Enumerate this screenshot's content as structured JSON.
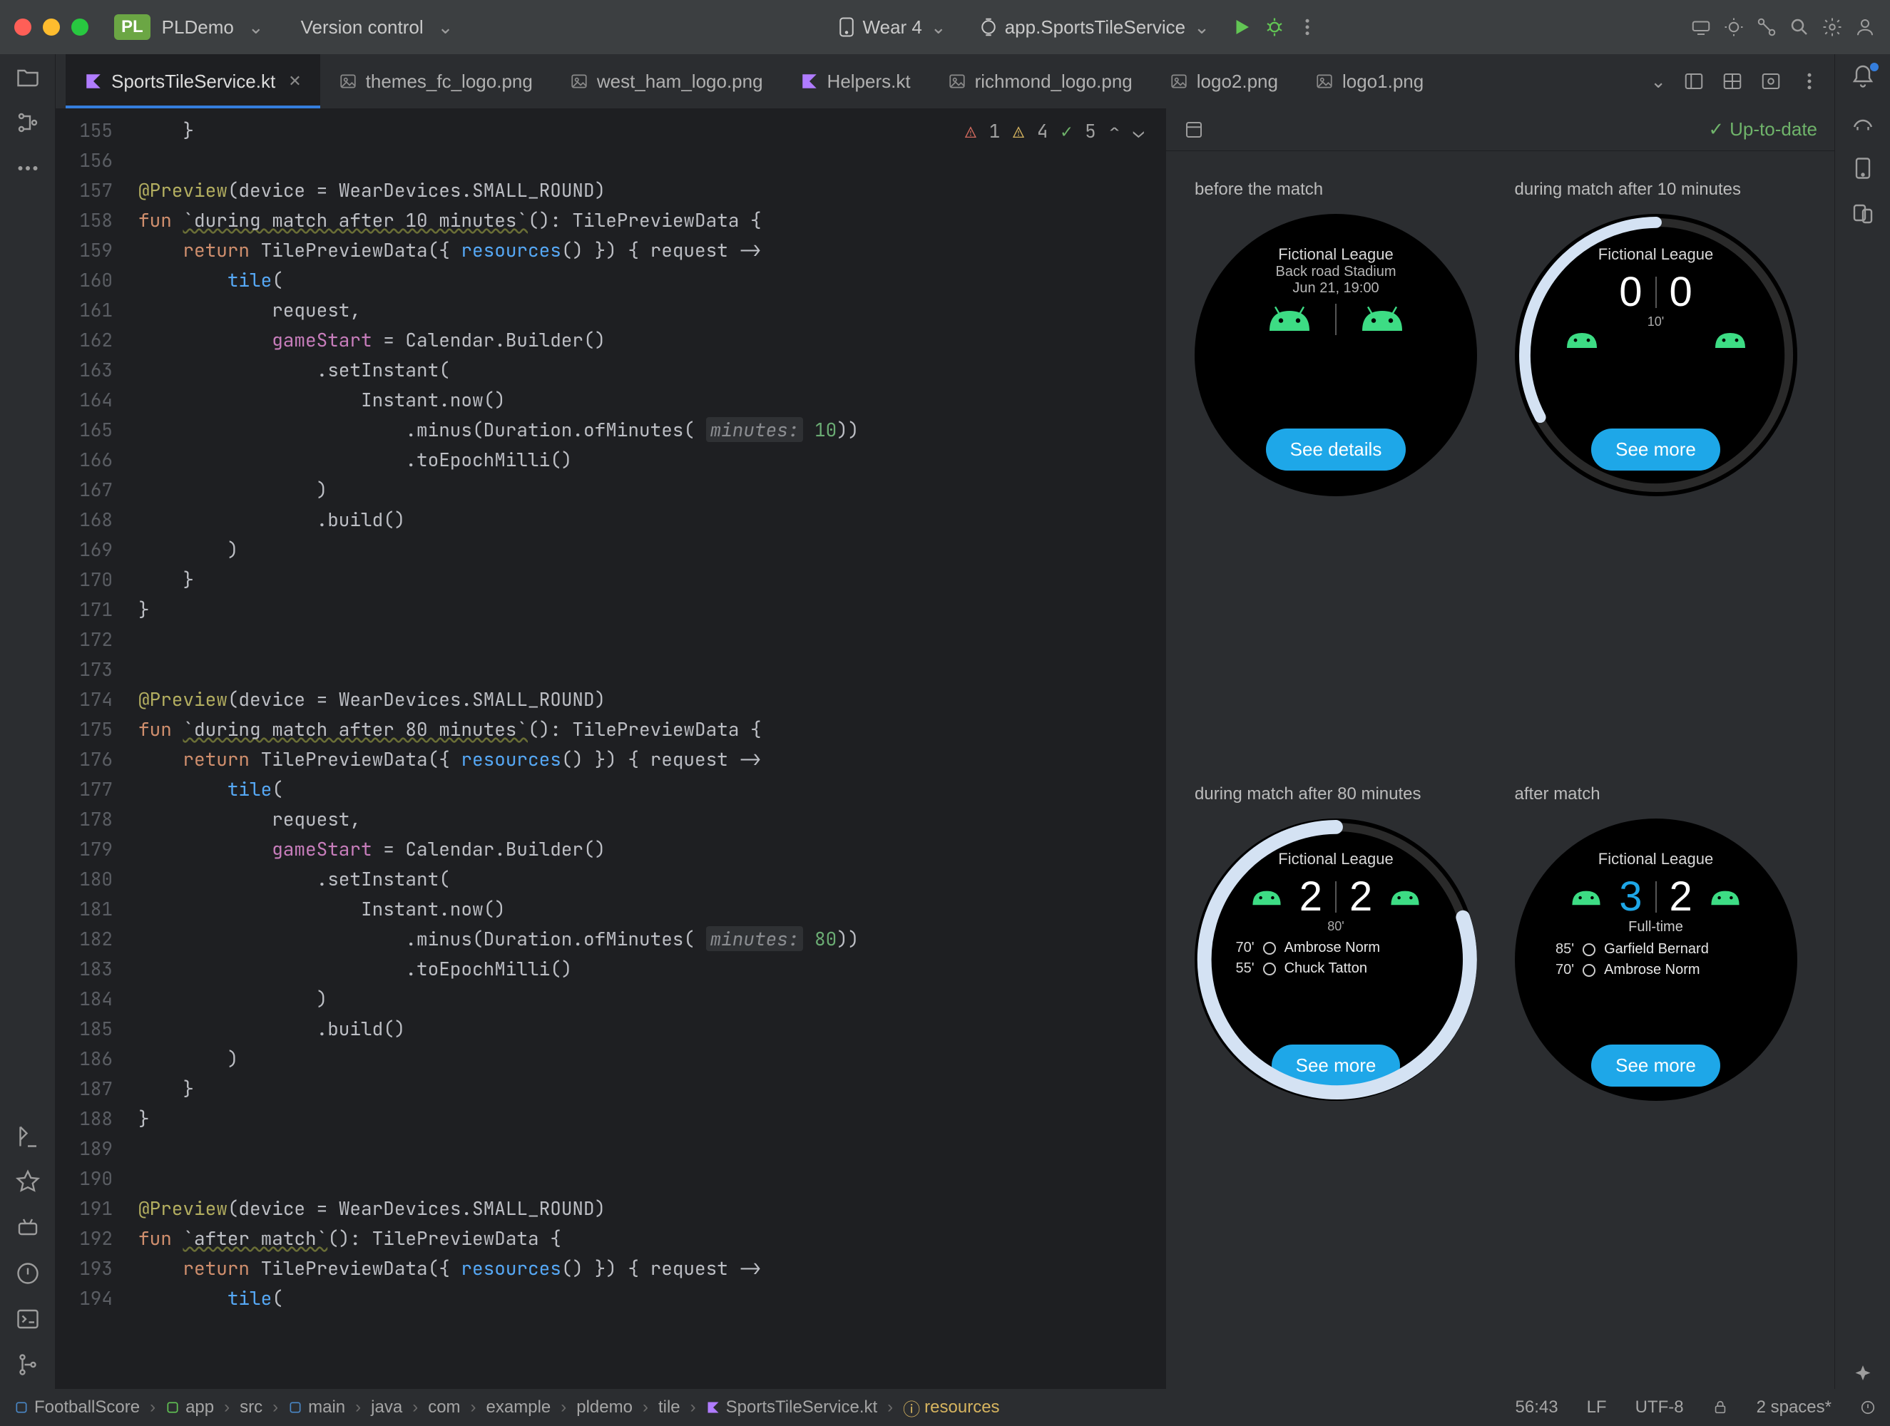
{
  "titlebar": {
    "project_badge": "PL",
    "project_name": "PLDemo",
    "vcs_label": "Version control",
    "device_label": "Wear 4",
    "run_config": "app.SportsTileService"
  },
  "tabs": [
    {
      "label": "SportsTileService.kt",
      "type": "kt",
      "active": true,
      "closable": true
    },
    {
      "label": "themes_fc_logo.png",
      "type": "img"
    },
    {
      "label": "west_ham_logo.png",
      "type": "img"
    },
    {
      "label": "Helpers.kt",
      "type": "kt"
    },
    {
      "label": "richmond_logo.png",
      "type": "img"
    },
    {
      "label": "logo2.png",
      "type": "img"
    },
    {
      "label": "logo1.png",
      "type": "img"
    }
  ],
  "inspections": {
    "errors": "1",
    "warnings": "4",
    "ok": "5"
  },
  "gutter_start": 155,
  "gutter_end": 194,
  "code": {
    "l155": "    }",
    "l157_ann": "@Preview",
    "l157_rest": "(device = WearDevices.SMALL_ROUND)",
    "l158_fun": "fun ",
    "l158_name": "`during match after 10 minutes`",
    "l158_rest": "(): TilePreviewData {",
    "l159_pre": "    ",
    "l159_kw": "return",
    "l159_rest": " TilePreviewData({ ",
    "l159_res": "resources",
    "l159_rest2": "() }) { request ->",
    "l160": "        ",
    "l160_fn": "tile",
    "l160_rest": "(",
    "l161": "            request,",
    "l162": "            ",
    "l162_prop": "gameStart",
    "l162_rest": " = Calendar.Builder()",
    "l163": "                .setInstant(",
    "l164": "                    Instant.now()",
    "l165_pre": "                        .minus(Duration.ofMinutes( ",
    "l165_hint": "minutes:",
    "l165_num": " 10",
    "l165_post": "))",
    "l166": "                        .toEpochMilli()",
    "l167": "                )",
    "l168": "                .build()",
    "l169": "        )",
    "l170": "    }",
    "l171": "}",
    "l174_ann": "@Preview",
    "l174_rest": "(device = WearDevices.SMALL_ROUND)",
    "l175_fun": "fun ",
    "l175_name": "`during match after 80 minutes`",
    "l175_rest": "(): TilePreviewData {",
    "l176_pre": "    ",
    "l176_kw": "return",
    "l176_rest": " TilePreviewData({ ",
    "l176_res": "resources",
    "l176_rest2": "() }) { request ->",
    "l177_fn": "tile",
    "l178": "            request,",
    "l179_prop": "gameStart",
    "l179_rest": " = Calendar.Builder()",
    "l180": "                .setInstant(",
    "l181": "                    Instant.now()",
    "l182_hint": "minutes:",
    "l182_num": " 80",
    "l183": "                        .toEpochMilli()",
    "l184": "                )",
    "l185": "                .build()",
    "l186": "        )",
    "l187": "    }",
    "l188": "}",
    "l191_ann": "@Preview",
    "l191_rest": "(device = WearDevices.SMALL_ROUND)",
    "l192_fun": "fun ",
    "l192_name": "`after match`",
    "l192_rest": "(): TilePreviewData {",
    "l193_kw": "return",
    "l193_rest": " TilePreviewData({ ",
    "l193_res": "resources",
    "l193_rest2": "() }) { request ->",
    "l194_fn": "tile"
  },
  "preview": {
    "status": "Up-to-date",
    "tiles": [
      {
        "title": "before the match",
        "league": "Fictional League",
        "sub1": "Back road Stadium",
        "sub2": "Jun 21, 19:00",
        "button": "See details"
      },
      {
        "title": "during match after 10 minutes",
        "league": "Fictional League",
        "scoreA": "0",
        "scoreB": "0",
        "time": "10'",
        "button": "See more"
      },
      {
        "title": "during match after 80 minutes",
        "league": "Fictional League",
        "scoreA": "2",
        "scoreB": "2",
        "time": "80'",
        "goals": [
          {
            "min": "70'",
            "name": "Ambrose Norm"
          },
          {
            "min": "55'",
            "name": "Chuck Tatton"
          }
        ],
        "button": "See more"
      },
      {
        "title": "after match",
        "league": "Fictional League",
        "scoreA": "3",
        "scoreB": "2",
        "status": "Full-time",
        "goals": [
          {
            "min": "85'",
            "name": "Garfield Bernard"
          },
          {
            "min": "70'",
            "name": "Ambrose Norm"
          }
        ],
        "button": "See more"
      }
    ]
  },
  "breadcrumbs": [
    "FootballScore",
    "app",
    "src",
    "main",
    "java",
    "com",
    "example",
    "pldemo",
    "tile",
    "SportsTileService.kt",
    "resources"
  ],
  "statusbar": {
    "pos": "56:43",
    "le": "LF",
    "enc": "UTF-8",
    "indent": "2 spaces*"
  }
}
